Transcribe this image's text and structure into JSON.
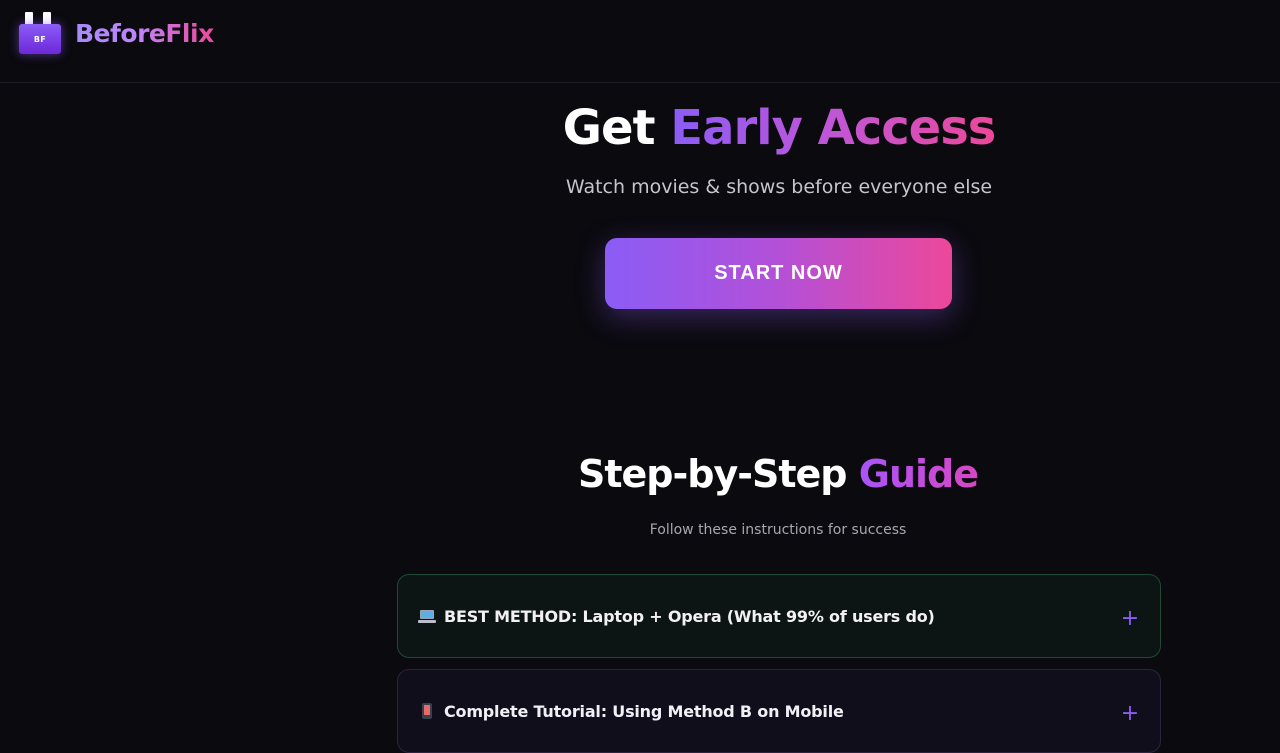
{
  "brand": {
    "name": "BeforeFlix",
    "badge": "BF"
  },
  "hero": {
    "title_plain": "Get",
    "title_accent": "Early Access",
    "subtitle": "Watch movies & shows before everyone else",
    "cta_label": "START NOW"
  },
  "guide": {
    "title_plain": "Step-by-Step",
    "title_accent": "Guide",
    "subtitle": "Follow these instructions for success",
    "items": [
      {
        "icon": "laptop-icon",
        "label": "BEST METHOD: Laptop + Opera (What 99% of users do)",
        "toggle": "+"
      },
      {
        "icon": "mobile-phone-icon",
        "label": "Complete Tutorial: Using Method B on Mobile",
        "toggle": "+"
      }
    ]
  },
  "colors": {
    "background": "#0b0a0f",
    "accent_purple": "#8b5cf6",
    "accent_pink": "#ec4899"
  }
}
